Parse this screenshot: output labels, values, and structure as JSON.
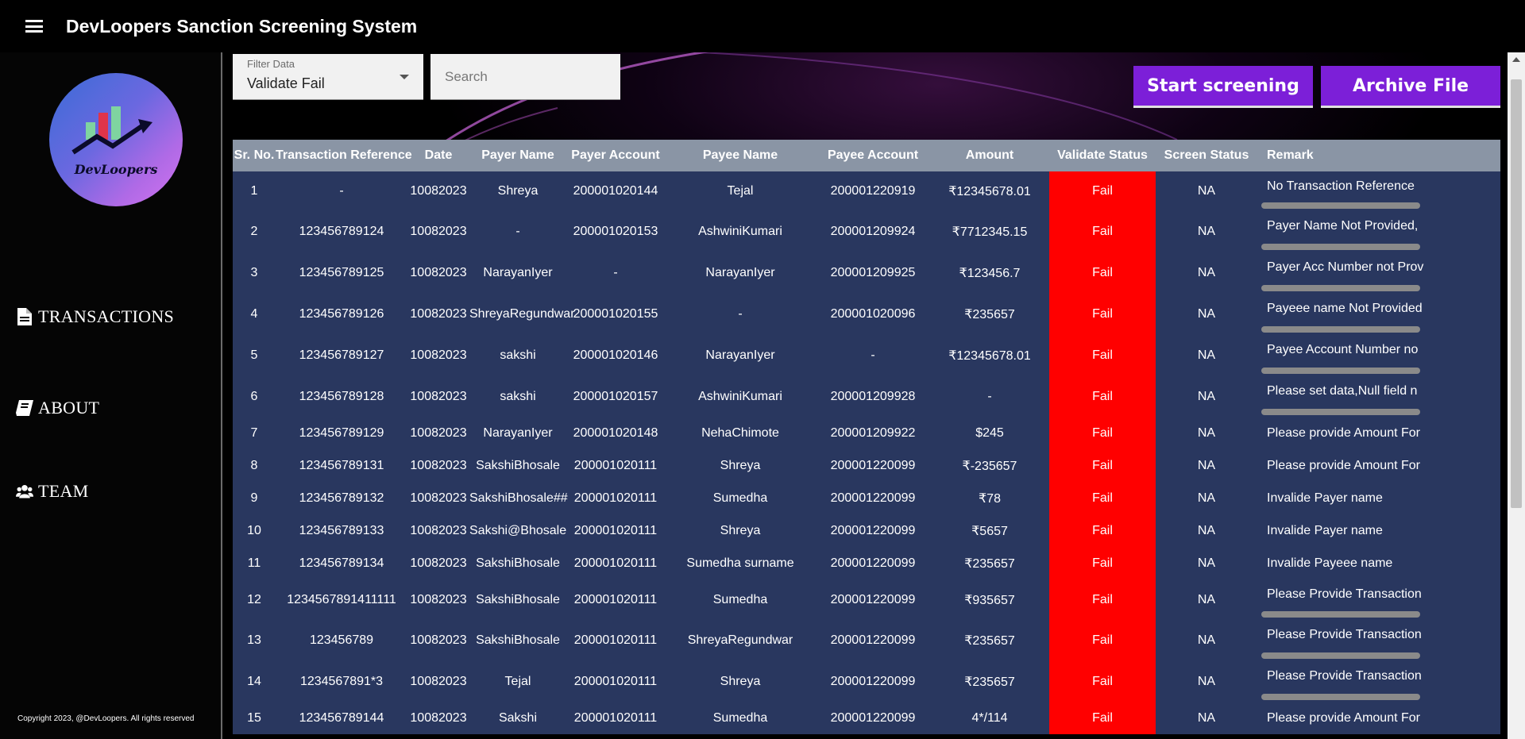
{
  "app": {
    "title": "DevLoopers Sanction Screening System"
  },
  "sidebar": {
    "logo_text": "DevLoopers",
    "items": [
      {
        "label": "TRANSACTIONS",
        "icon": "file-icon"
      },
      {
        "label": "ABOUT",
        "icon": "book-icon"
      },
      {
        "label": "TEAM",
        "icon": "users-icon"
      }
    ],
    "copyright": "Copyright 2023, @DevLoopers. All rights reserved"
  },
  "filter": {
    "label": "Filter Data",
    "value": "Validate Fail"
  },
  "search": {
    "placeholder": "Search"
  },
  "actions": {
    "start_label": "Start screening",
    "archive_label": "Archive File"
  },
  "colors": {
    "accent": "#7c1fd8",
    "table_row": "#29375f",
    "table_header": "#8a95a5",
    "fail": "#ff0000"
  },
  "table": {
    "columns": [
      "Sr. No.",
      "Transaction Reference",
      "Date",
      "Payer Name",
      "Payer Account",
      "Payee Name",
      "Payee Account",
      "Amount",
      "Validate Status",
      "Screen Status",
      "Remark"
    ],
    "rows": [
      [
        "1",
        "-",
        "10082023",
        "Shreya",
        "200001020144",
        "Tejal",
        "200001220919",
        "₹12345678.01",
        "Fail",
        "NA",
        "No Transaction Reference"
      ],
      [
        "2",
        "123456789124",
        "10082023",
        "-",
        "200001020153",
        "AshwiniKumari",
        "200001209924",
        "₹7712345.15",
        "Fail",
        "NA",
        "Payer Name Not Provided,"
      ],
      [
        "3",
        "123456789125",
        "10082023",
        "NarayanIyer",
        "-",
        "NarayanIyer",
        "200001209925",
        "₹123456.7",
        "Fail",
        "NA",
        "Payer Acc Number not Prov"
      ],
      [
        "4",
        "123456789126",
        "10082023",
        "ShreyaRegundwar",
        "200001020155",
        "-",
        "200001020096",
        "₹235657",
        "Fail",
        "NA",
        "Payeee name Not Provided"
      ],
      [
        "5",
        "123456789127",
        "10082023",
        "sakshi",
        "200001020146",
        "NarayanIyer",
        "-",
        "₹12345678.01",
        "Fail",
        "NA",
        "Payee Account Number no"
      ],
      [
        "6",
        "123456789128",
        "10082023",
        "sakshi",
        "200001020157",
        "AshwiniKumari",
        "200001209928",
        "-",
        "Fail",
        "NA",
        "Please set data,Null field n"
      ],
      [
        "7",
        "123456789129",
        "10082023",
        "NarayanIyer",
        "200001020148",
        "NehaChimote",
        "200001209922",
        "$245",
        "Fail",
        "NA",
        "Please provide Amount For"
      ],
      [
        "8",
        "123456789131",
        "10082023",
        "SakshiBhosale",
        "200001020111",
        "Shreya",
        "200001220099",
        "₹-235657",
        "Fail",
        "NA",
        "Please provide Amount For"
      ],
      [
        "9",
        "123456789132",
        "10082023",
        "SakshiBhosale##",
        "200001020111",
        "Sumedha",
        "200001220099",
        "₹78",
        "Fail",
        "NA",
        "Invalide Payer name"
      ],
      [
        "10",
        "123456789133",
        "10082023",
        "Sakshi@Bhosale",
        "200001020111",
        "Shreya",
        "200001220099",
        "₹5657",
        "Fail",
        "NA",
        "Invalide Payer name"
      ],
      [
        "11",
        "123456789134",
        "10082023",
        "SakshiBhosale",
        "200001020111",
        "Sumedha surname",
        "200001220099",
        "₹235657",
        "Fail",
        "NA",
        "Invalide Payeee name"
      ],
      [
        "12",
        "1234567891411111",
        "10082023",
        "SakshiBhosale",
        "200001020111",
        "Sumedha",
        "200001220099",
        "₹935657",
        "Fail",
        "NA",
        "Please Provide Transaction"
      ],
      [
        "13",
        "123456789",
        "10082023",
        "SakshiBhosale",
        "200001020111",
        "ShreyaRegundwar",
        "200001220099",
        "₹235657",
        "Fail",
        "NA",
        "Please Provide Transaction"
      ],
      [
        "14",
        "1234567891*3",
        "10082023",
        "Tejal",
        "200001020111",
        "Shreya",
        "200001220099",
        "₹235657",
        "Fail",
        "NA",
        "Please Provide Transaction"
      ],
      [
        "15",
        "123456789144",
        "10082023",
        "Sakshi",
        "200001020111",
        "Sumedha",
        "200001220099",
        "4*/114",
        "Fail",
        "NA",
        "Please provide Amount For"
      ]
    ]
  }
}
